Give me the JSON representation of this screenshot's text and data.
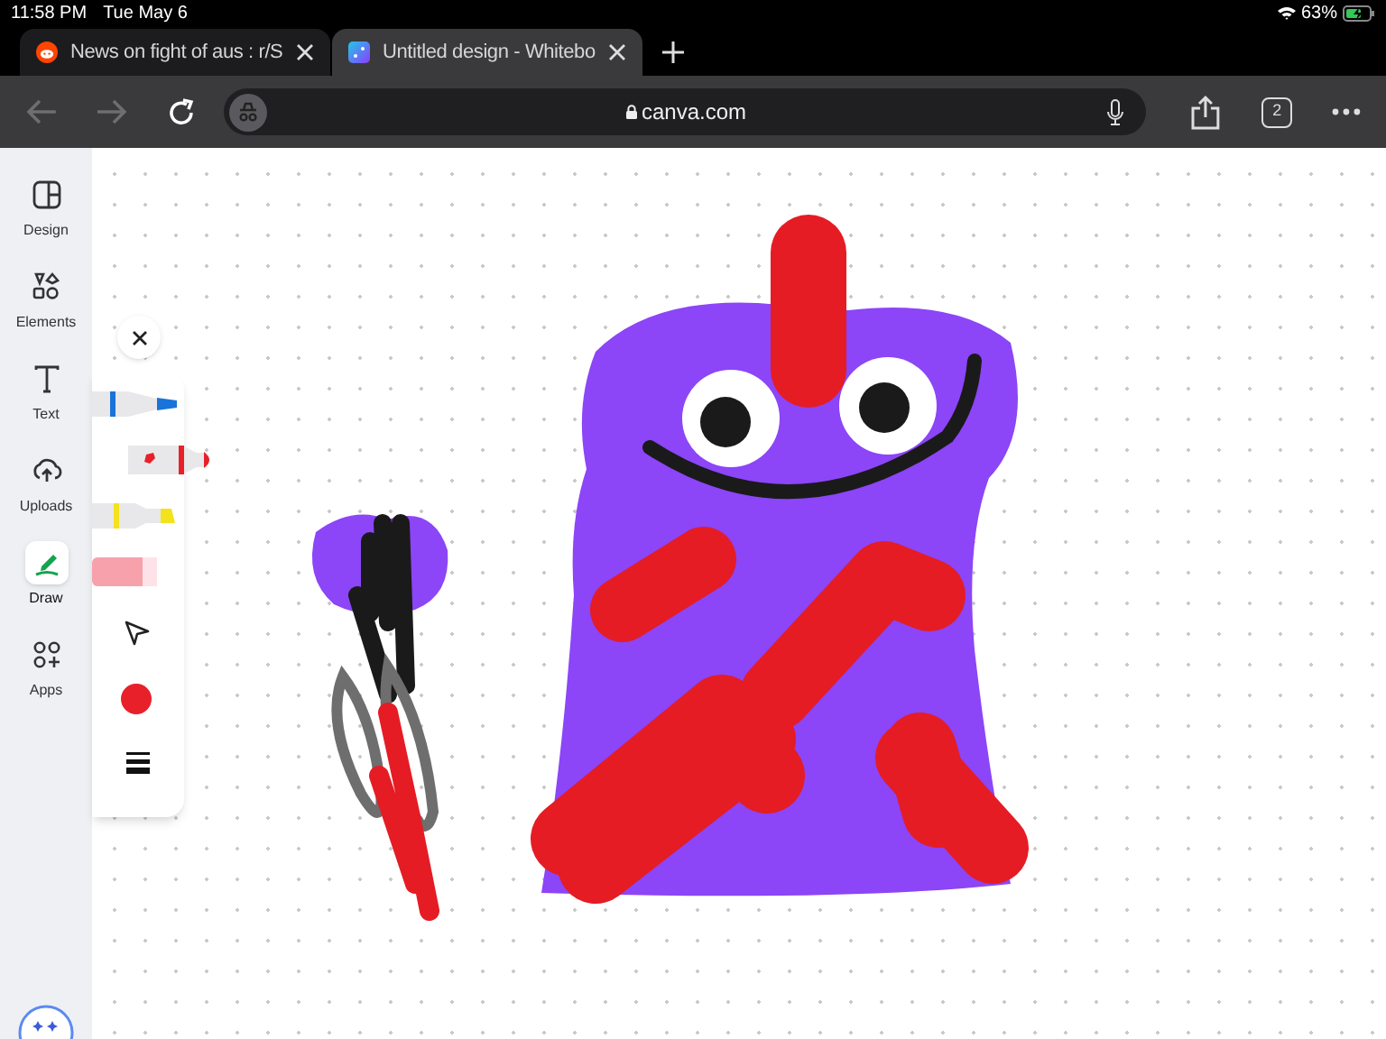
{
  "status_bar": {
    "time": "11:58 PM",
    "date": "Tue May 6",
    "battery": "63%",
    "charging": true
  },
  "tabs": [
    {
      "title": "News on fight of aus : r/S",
      "selected": false,
      "kind": "reddit"
    },
    {
      "title": "Untitled design - Whitebo",
      "selected": true,
      "kind": "canva"
    }
  ],
  "toolbar": {
    "url": "canva.com",
    "tab_count": "2",
    "back_enabled": false,
    "forward_enabled": false
  },
  "sidebar": {
    "items": [
      {
        "label": "Design",
        "kind": "design",
        "selected": false
      },
      {
        "label": "Elements",
        "kind": "elements",
        "selected": false
      },
      {
        "label": "Text",
        "kind": "text",
        "selected": false
      },
      {
        "label": "Uploads",
        "kind": "uploads",
        "selected": false
      },
      {
        "label": "Draw",
        "kind": "draw",
        "selected": true
      },
      {
        "label": "Apps",
        "kind": "apps",
        "selected": false
      }
    ]
  },
  "draw_tools": [
    {
      "kind": "pen",
      "color": "#1a73d9",
      "selected": false
    },
    {
      "kind": "marker",
      "color": "#e8202a",
      "selected": true
    },
    {
      "kind": "highlighter",
      "color": "#f4e21c",
      "selected": false
    },
    {
      "kind": "eraser",
      "color": "#f7a1ad",
      "selected": false
    }
  ],
  "draw_color": {
    "color": "#e8202a"
  }
}
